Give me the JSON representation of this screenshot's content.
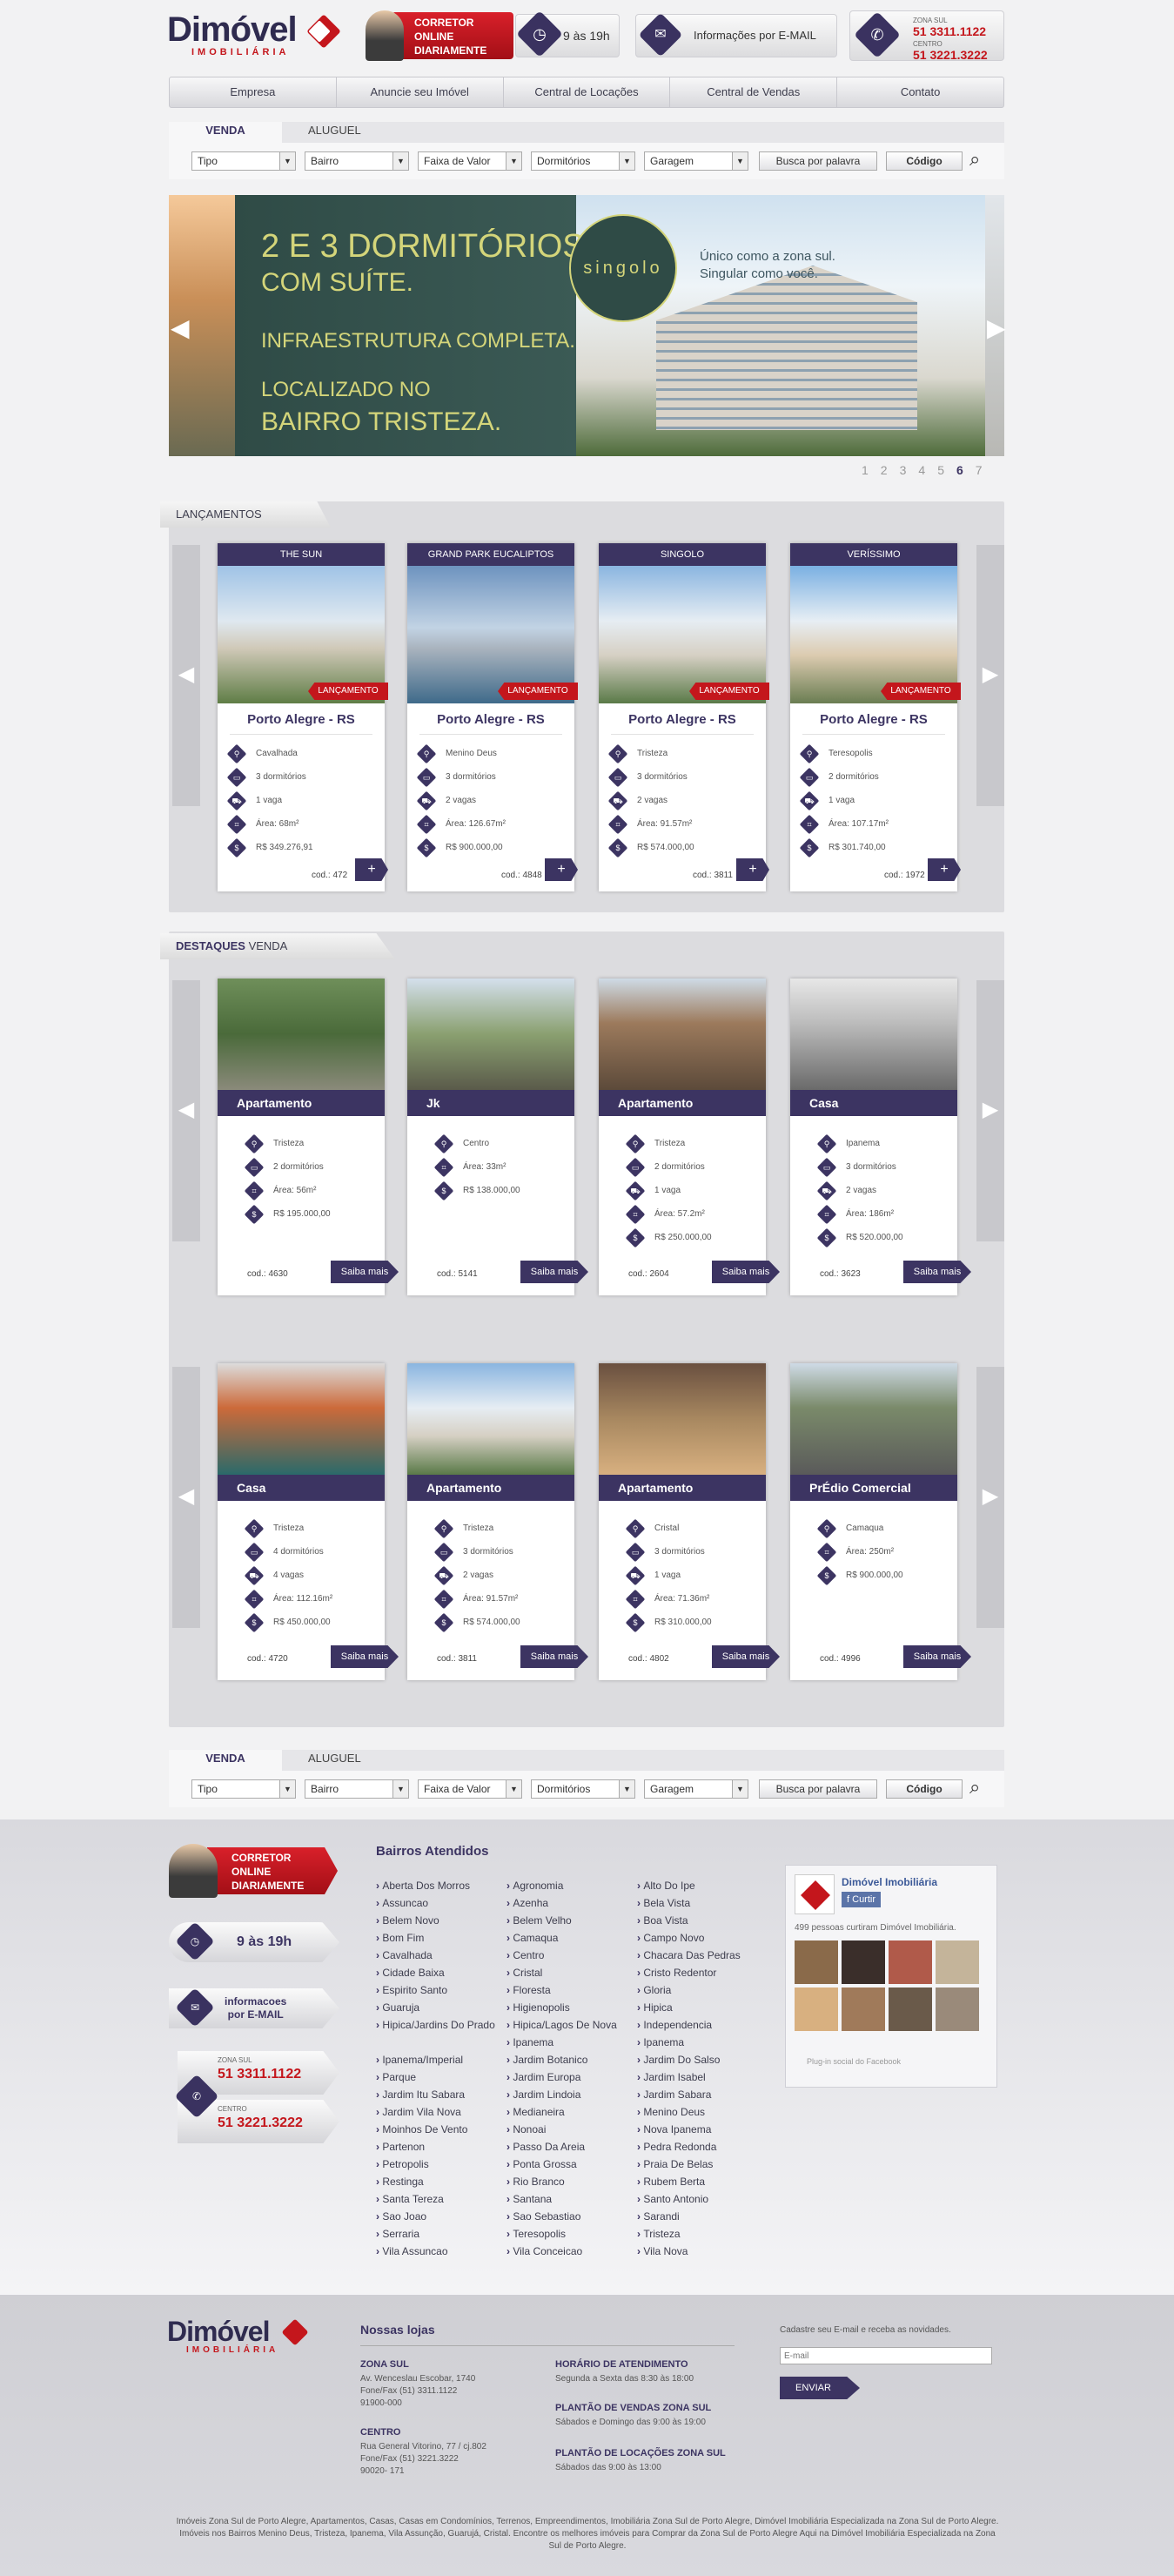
{
  "brand": {
    "name": "Dimóvel",
    "sub": "IMOBILIÁRIA",
    "accent": "#c4161c",
    "primary": "#3c3462"
  },
  "header": {
    "corretor": [
      "CORRETOR",
      "ONLINE",
      "DIARIAMENTE"
    ],
    "hours": "9 às 19h",
    "email": "Informações por E-MAIL",
    "zona_sul_label": "ZONA SUL",
    "zona_sul_phone": "51 3311.1122",
    "centro_label": "CENTRO",
    "centro_phone": "51 3221.3222"
  },
  "nav": [
    "Empresa",
    "Anuncie seu Imóvel",
    "Central de Locações",
    "Central de Vendas",
    "Contato"
  ],
  "search": {
    "tabs": [
      "VENDA",
      "ALUGUEL"
    ],
    "selects": [
      "Tipo",
      "Bairro",
      "Faixa de Valor",
      "Dormitórios",
      "Garagem"
    ],
    "keyword": "Busca por palavra",
    "code": "Código"
  },
  "banner": {
    "line1": "2 E 3 DORMITÓRIOS",
    "line2": "COM SUÍTE.",
    "line3": "INFRAESTRUTURA COMPLETA.",
    "line4": "LOCALIZADO NO",
    "line5": "BAIRRO TRISTEZA.",
    "brand": "singolo",
    "tagline1": "Único como a zona sul.",
    "tagline2": "Singular como você.",
    "pages": [
      "1",
      "2",
      "3",
      "4",
      "5",
      "6",
      "7"
    ]
  },
  "lancamentos": {
    "tag": "LANÇAMENTOS",
    "ribbon": "LANÇAMENTO",
    "items": [
      {
        "name": "THE SUN",
        "city": "Porto Alegre - RS",
        "rows": [
          "Cavalhada",
          "3 dormitórios",
          "1 vaga",
          "Área: 68m²",
          "R$ 349.276,91"
        ],
        "cod": "cod.: 472"
      },
      {
        "name": "GRAND PARK EUCALIPTOS",
        "city": "Porto Alegre - RS",
        "rows": [
          "Menino Deus",
          "3 dormitórios",
          "2 vagas",
          "Área: 126.67m²",
          "R$ 900.000,00"
        ],
        "cod": "cod.: 4848"
      },
      {
        "name": "SINGOLO",
        "city": "Porto Alegre - RS",
        "rows": [
          "Tristeza",
          "3 dormitórios",
          "2 vagas",
          "Área: 91.57m²",
          "R$ 574.000,00"
        ],
        "cod": "cod.: 3811"
      },
      {
        "name": "VERÍSSIMO",
        "city": "Porto Alegre - RS",
        "rows": [
          "Teresopolis",
          "2 dormitórios",
          "1 vaga",
          "Área: 107.17m²",
          "R$ 301.740,00"
        ],
        "cod": "cod.: 1972"
      }
    ]
  },
  "destaques": {
    "tag1": "DESTAQUES",
    "tag2": "VENDA",
    "saiba": "Saiba mais",
    "items": [
      {
        "title": "Apartamento",
        "rows": [
          "Tristeza",
          "2 dormitórios",
          "Área: 56m²",
          "R$ 195.000,00"
        ],
        "cod": "cod.: 4630"
      },
      {
        "title": "Jk",
        "rows": [
          "Centro",
          "Área: 33m²",
          "R$ 138.000,00"
        ],
        "cod": "cod.: 5141"
      },
      {
        "title": "Apartamento",
        "rows": [
          "Tristeza",
          "2 dormitórios",
          "1 vaga",
          "Área: 57.2m²",
          "R$ 250.000,00"
        ],
        "cod": "cod.: 2604"
      },
      {
        "title": "Casa",
        "rows": [
          "Ipanema",
          "3 dormitórios",
          "2 vagas",
          "Área: 186m²",
          "R$ 520.000,00"
        ],
        "cod": "cod.: 3623"
      },
      {
        "title": "Casa",
        "rows": [
          "Tristeza",
          "4 dormitórios",
          "4 vagas",
          "Área: 112.16m²",
          "R$ 450.000,00"
        ],
        "cod": "cod.: 4720"
      },
      {
        "title": "Apartamento",
        "rows": [
          "Tristeza",
          "3 dormitórios",
          "2 vagas",
          "Área: 91.57m²",
          "R$ 574.000,00"
        ],
        "cod": "cod.: 3811"
      },
      {
        "title": "Apartamento",
        "rows": [
          "Cristal",
          "3 dormitórios",
          "1 vaga",
          "Área: 71.36m²",
          "R$ 310.000,00"
        ],
        "cod": "cod.: 4802"
      },
      {
        "title": "PrÉdio Comercial",
        "rows": [
          "Camaqua",
          "Área: 250m²",
          "R$ 900.000,00"
        ],
        "cod": "cod.: 4996"
      }
    ]
  },
  "footer": {
    "bairros_title": "Bairros Atendidos",
    "corretor": [
      "CORRETOR",
      "ONLINE",
      "DIARIAMENTE"
    ],
    "hours": "9 às 19h",
    "email": [
      "informacoes",
      "por E-MAIL"
    ],
    "zona_sul_label": "ZONA SUL",
    "zona_sul_phone": "51 3311.1122",
    "centro_label": "CENTRO",
    "centro_phone": "51 3221.3222",
    "col1": [
      "Aberta Dos Morros",
      "Assuncao",
      "Belem Novo",
      "Bom Fim",
      "Cavalhada",
      "Cidade Baixa",
      "Espirito Santo",
      "Guaruja",
      "Hipica/Jardins Do Prado",
      "",
      "Ipanema/Imperial",
      "Parque",
      "Jardim Itu Sabara",
      "Jardim Vila Nova",
      "Moinhos De Vento",
      "Partenon",
      "Petropolis",
      "Restinga",
      "Santa Tereza",
      "Sao Joao",
      "Serraria",
      "Vila Assuncao"
    ],
    "col2": [
      "Agronomia",
      "Azenha",
      "Belem Velho",
      "Camaqua",
      "Centro",
      "Cristal",
      "Floresta",
      "Higienopolis",
      "Hipica/Lagos De Nova",
      "Ipanema",
      "Jardim Botanico",
      "Jardim Europa",
      "Jardim Lindoia",
      "Medianeira",
      "Nonoai",
      "Passo Da Areia",
      "Ponta Grossa",
      "Rio Branco",
      "Santana",
      "Sao Sebastiao",
      "Teresopolis",
      "Vila Conceicao"
    ],
    "col3": [
      "Alto Do Ipe",
      "Bela Vista",
      "Boa Vista",
      "Campo Novo",
      "Chacara Das Pedras",
      "Cristo Redentor",
      "Gloria",
      "Hipica",
      "Independencia",
      "Ipanema",
      "Jardim Do Salso",
      "Jardim Isabel",
      "Jardim Sabara",
      "Menino Deus",
      "Nova Ipanema",
      "Pedra Redonda",
      "Praia De Belas",
      "Rubem Berta",
      "Santo Antonio",
      "Sarandi",
      "Tristeza",
      "Vila Nova"
    ],
    "fb_name": "Dimóvel Imobiliária",
    "fb_like": "Curtir",
    "fb_count": "499 pessoas curtiram Dimóvel Imobiliária.",
    "fb_plugin": "Plug-in social do Facebook",
    "lojas_title": "Nossas lojas",
    "zona_sul_h": "ZONA SUL",
    "zona_sul_addr": [
      "Av. Wenceslau Escobar, 1740",
      "Fone/Fax (51) 3311.1122",
      "91900-000"
    ],
    "centro_h": "CENTRO",
    "centro_addr": [
      "Rua General Vitorino, 77 / cj.802",
      "Fone/Fax (51) 3221.3222",
      "90020- 171"
    ],
    "horario_h": "HORÁRIO DE ATENDIMENTO",
    "horario_t": "Segunda a Sexta das 8:30 às 18:00",
    "plantao_v_h": "PLANTÃO DE VENDAS ZONA SUL",
    "plantao_v_t": "Sábados e Domingo das 9:00 às 19:00",
    "plantao_l_h": "PLANTÃO DE LOCAÇÕES ZONA SUL",
    "plantao_l_t": "Sábados das 9:00 às 13:00",
    "news_title": "Cadastre seu E-mail e receba as novidades.",
    "news_placeholder": "E-mail",
    "news_btn": "ENVIAR",
    "seo": "Imóveis Zona Sul de Porto Alegre, Apartamentos, Casas, Casas em Condomínios, Terrenos, Empreendimentos, Imobiliária Zona Sul de Porto Alegre, Dimóvel Imobiliária Especializada na Zona Sul de Porto Alegre. Imóveis nos Bairros Menino Deus, Tristeza, Ipanema, Vila Assunção, Guarujá, Cristal. Encontre os melhores imóveis para Comprar da Zona Sul de Porto Alegre Aqui na Dimóvel Imobiliária Especializada na Zona Sul de Porto Alegre."
  }
}
